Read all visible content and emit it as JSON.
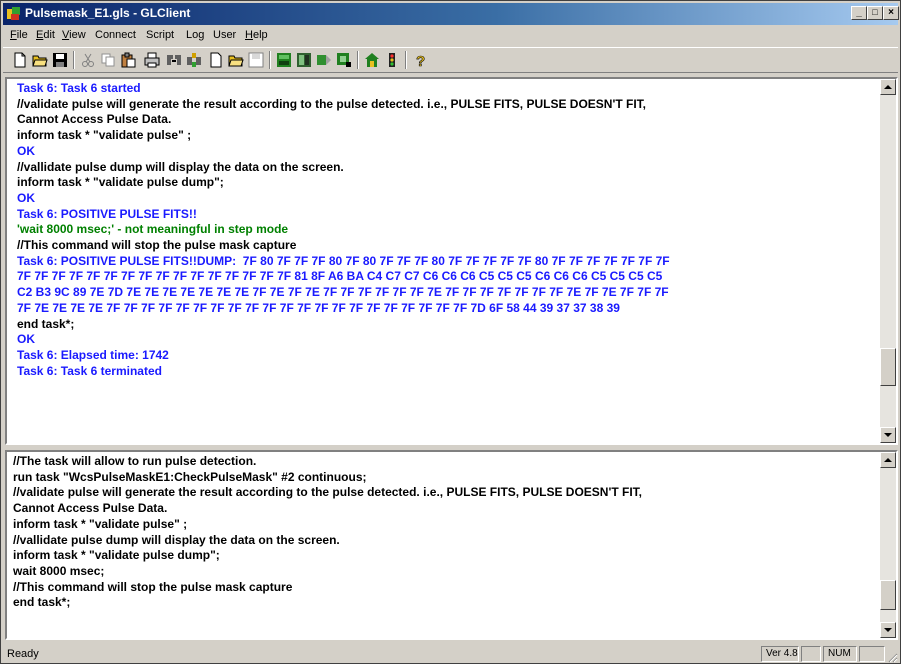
{
  "window": {
    "title": "Pulsemask_E1.gls - GLClient",
    "controls": {
      "minimize": "_",
      "maximize": "□",
      "close": "×"
    }
  },
  "menu": [
    {
      "label": "File",
      "ul": "F",
      "rest": "ile"
    },
    {
      "label": "Edit",
      "ul": "E",
      "rest": "dit"
    },
    {
      "label": "View",
      "ul": "V",
      "rest": "iew"
    },
    {
      "label": "Connect",
      "ul": "",
      "rest": "Connect"
    },
    {
      "label": "Script",
      "ul": "",
      "rest": "Script"
    },
    {
      "label": "Log",
      "ul": "",
      "rest": "Log"
    },
    {
      "label": "User",
      "ul": "",
      "rest": "User"
    },
    {
      "label": "Help",
      "ul": "H",
      "rest": "elp"
    }
  ],
  "toolbar": {
    "icons": [
      "new-file-icon",
      "open-folder-icon",
      "save-icon",
      "cut-icon",
      "copy-icon",
      "paste-icon",
      "print-icon",
      "connect-icon",
      "disconnect-icon",
      "new-script-icon",
      "open-script-icon",
      "save-script-icon",
      "run-icon",
      "stop-icon",
      "step-icon",
      "log-icon",
      "user-icon",
      "alert-icon",
      "help-icon"
    ]
  },
  "output_pane": {
    "lines": [
      {
        "text": "Task 6: Task 6 started",
        "color": "blue"
      },
      {
        "text": "//validate pulse will generate the result according to the pulse detected. i.e., PULSE FITS, PULSE DOESN'T FIT,",
        "color": "black"
      },
      {
        "text": "Cannot Access Pulse Data.",
        "color": "black"
      },
      {
        "text": "inform task * \"validate pulse\" ;",
        "color": "black"
      },
      {
        "text": "OK",
        "color": "blue"
      },
      {
        "text": "//vallidate pulse dump will display the data on the screen.",
        "color": "black"
      },
      {
        "text": "inform task * \"validate pulse dump\";",
        "color": "black"
      },
      {
        "text": "OK",
        "color": "blue"
      },
      {
        "text": "Task 6: POSITIVE PULSE FITS!!",
        "color": "blue"
      },
      {
        "text": "'wait 8000 msec;' - not meaningful in step mode",
        "color": "green"
      },
      {
        "text": "//This command will stop the pulse mask capture",
        "color": "black"
      },
      {
        "text": "Task 6: POSITIVE PULSE FITS!!DUMP:  7F 80 7F 7F 7F 80 7F 80 7F 7F 7F 80 7F 7F 7F 7F 7F 80 7F 7F 7F 7F 7F 7F 7F",
        "color": "blue"
      },
      {
        "text": "7F 7F 7F 7F 7F 7F 7F 7F 7F 7F 7F 7F 7F 7F 7F 7F 81 8F A6 BA C4 C7 C7 C6 C6 C6 C5 C5 C5 C6 C6 C6 C5 C5 C5 C5",
        "color": "blue"
      },
      {
        "text": "C2 B3 9C 89 7E 7D 7E 7E 7E 7E 7E 7E 7E 7F 7E 7F 7E 7F 7F 7F 7F 7F 7F 7E 7F 7F 7F 7F 7F 7F 7F 7E 7F 7E 7F 7F 7F",
        "color": "blue"
      },
      {
        "text": "7F 7E 7E 7E 7E 7F 7F 7F 7F 7F 7F 7F 7F 7F 7F 7F 7F 7F 7F 7F 7F 7F 7F 7F 7F 7F 7D 6F 58 44 39 37 37 38 39",
        "color": "blue"
      },
      {
        "text": "end task*;",
        "color": "black"
      },
      {
        "text": "OK",
        "color": "blue"
      },
      {
        "text": "Task 6: Elapsed time: 1742",
        "color": "blue"
      },
      {
        "text": "Task 6: Task 6 terminated",
        "color": "blue"
      }
    ],
    "scroll_position": 0.86
  },
  "script_pane": {
    "lines": [
      {
        "text": "//The task will allow to run pulse detection.",
        "color": "black"
      },
      {
        "text": "run task \"WcsPulseMaskE1:CheckPulseMask\" #2 continuous;",
        "color": "black"
      },
      {
        "text": "//validate pulse will generate the result according to the pulse detected. i.e., PULSE FITS, PULSE DOESN'T FIT,",
        "color": "black"
      },
      {
        "text": "Cannot Access Pulse Data.",
        "color": "black"
      },
      {
        "text": "inform task * \"validate pulse\" ;",
        "color": "black"
      },
      {
        "text": "//vallidate pulse dump will display the data on the screen.",
        "color": "black"
      },
      {
        "text": "inform task * \"validate pulse dump\";",
        "color": "black"
      },
      {
        "text": "wait 8000 msec;",
        "color": "black"
      },
      {
        "text": "//This command will stop the pulse mask capture",
        "color": "black"
      },
      {
        "text": "end task*;",
        "color": "black"
      }
    ],
    "scroll_position": 0.9
  },
  "status": {
    "text": "Ready",
    "version": "Ver 4.8",
    "num": "NUM"
  },
  "colors": {
    "blue": "#1a1aff",
    "green": "#008000",
    "black": "#000000"
  }
}
